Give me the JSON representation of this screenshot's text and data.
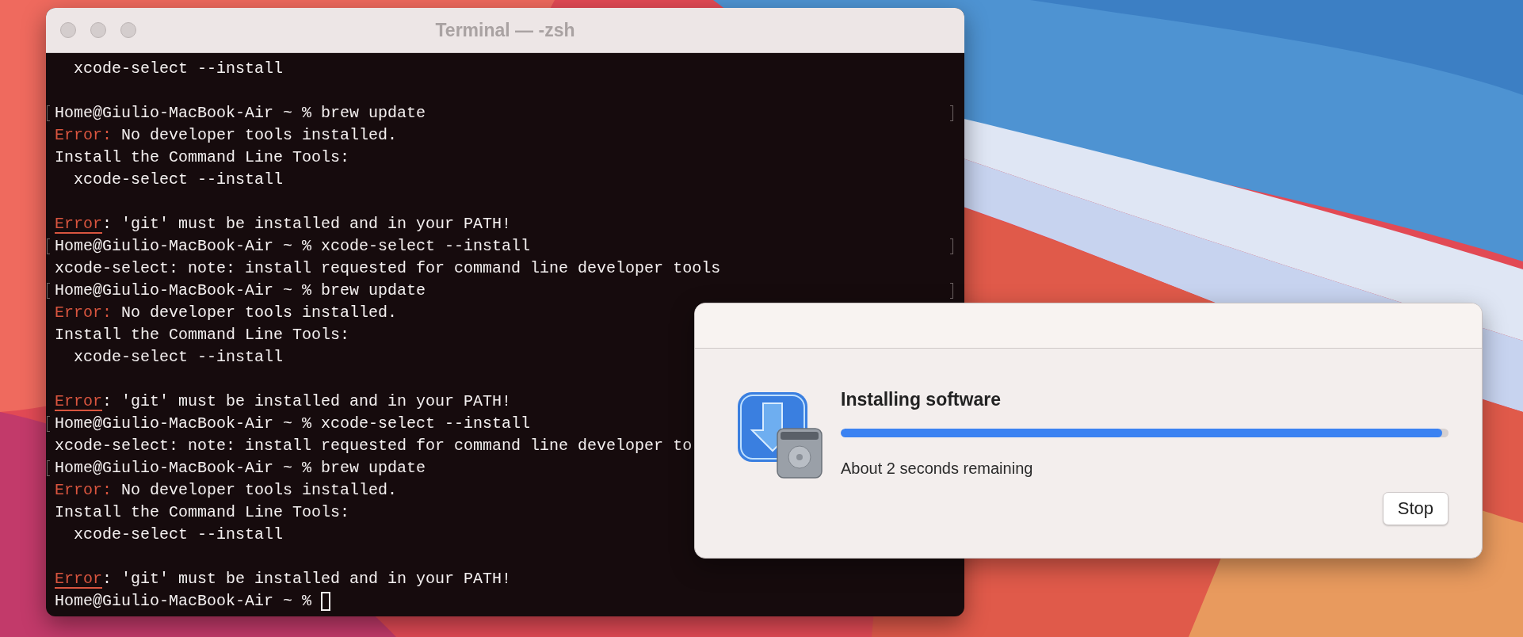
{
  "terminal": {
    "title": "Terminal — -zsh",
    "lines": [
      {
        "kind": "output",
        "text": "  xcode-select --install"
      },
      {
        "kind": "blank"
      },
      {
        "kind": "prompt",
        "prompt": "Home@Giulio-MacBook-Air ~ %",
        "command": "brew update",
        "mark_start": true,
        "mark_end": true
      },
      {
        "kind": "error",
        "label": "Error:",
        "text": " No developer tools installed.",
        "underline": false
      },
      {
        "kind": "output",
        "text": "Install the Command Line Tools:"
      },
      {
        "kind": "output",
        "text": "  xcode-select --install"
      },
      {
        "kind": "blank"
      },
      {
        "kind": "error",
        "label": "Error",
        "text": ": 'git' must be installed and in your PATH!",
        "underline": true
      },
      {
        "kind": "prompt",
        "prompt": "Home@Giulio-MacBook-Air ~ %",
        "command": "xcode-select --install",
        "mark_start": true,
        "mark_end": true
      },
      {
        "kind": "output",
        "text": "xcode-select: note: install requested for command line developer tools"
      },
      {
        "kind": "prompt",
        "prompt": "Home@Giulio-MacBook-Air ~ %",
        "command": "brew update",
        "mark_start": true,
        "mark_end": true
      },
      {
        "kind": "error",
        "label": "Error:",
        "text": " No developer tools installed.",
        "underline": false
      },
      {
        "kind": "output",
        "text": "Install the Command Line Tools:"
      },
      {
        "kind": "output",
        "text": "  xcode-select --install"
      },
      {
        "kind": "blank"
      },
      {
        "kind": "error",
        "label": "Error",
        "text": ": 'git' must be installed and in your PATH!",
        "underline": true
      },
      {
        "kind": "prompt",
        "prompt": "Home@Giulio-MacBook-Air ~ %",
        "command": "xcode-select --install",
        "mark_start": true,
        "mark_end": false
      },
      {
        "kind": "output",
        "text": "xcode-select: note: install requested for command line developer to"
      },
      {
        "kind": "prompt",
        "prompt": "Home@Giulio-MacBook-Air ~ %",
        "command": "brew update",
        "mark_start": true,
        "mark_end": false
      },
      {
        "kind": "error",
        "label": "Error:",
        "text": " No developer tools installed.",
        "underline": false
      },
      {
        "kind": "output",
        "text": "Install the Command Line Tools:"
      },
      {
        "kind": "output",
        "text": "  xcode-select --install"
      },
      {
        "kind": "blank"
      },
      {
        "kind": "error",
        "label": "Error",
        "text": ": 'git' must be installed and in your PATH!",
        "underline": true
      },
      {
        "kind": "prompt",
        "prompt": "Home@Giulio-MacBook-Air ~ %",
        "mark_start": false,
        "mark_end": false,
        "cursor": true
      }
    ]
  },
  "installer": {
    "title": "Installing software",
    "progress": {
      "level": 0.99
    },
    "status": "About 2 seconds remaining",
    "buttons": [
      "Stop"
    ]
  }
}
